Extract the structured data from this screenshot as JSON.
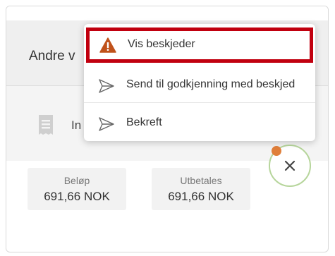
{
  "header": {
    "title": "Andre v"
  },
  "item": {
    "text": "In"
  },
  "amounts": [
    {
      "label": "Beløp",
      "value": "691,66 NOK"
    },
    {
      "label": "Utbetales",
      "value": "691,66 NOK"
    }
  ],
  "menu": {
    "items": [
      {
        "label": "Vis beskjeder",
        "icon": "warning-icon"
      },
      {
        "label": "Send til godkjenning med beskjed",
        "icon": "send-icon"
      },
      {
        "label": "Bekreft",
        "icon": "send-icon"
      }
    ]
  },
  "colors": {
    "highlight_border": "#c1000f",
    "warning": "#c0521b",
    "close_ring": "#b6d59b",
    "notification": "#e07f3a"
  }
}
